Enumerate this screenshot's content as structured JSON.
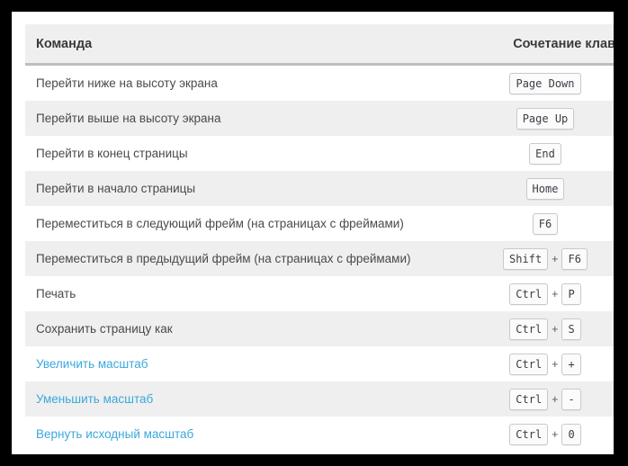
{
  "table": {
    "headers": {
      "command": "Команда",
      "shortcut": "Сочетание клавиш"
    },
    "colors": {
      "link": "#3ba7dd",
      "text": "#4a4a4a",
      "header_bg": "#efefef",
      "stripe_bg": "#efefef",
      "key_bg": "#fbfbfb",
      "key_border": "#c9c9c9",
      "page_bg": "#ffffff",
      "frame": "#000000"
    },
    "rows": [
      {
        "command": "Перейти ниже на высоту экрана",
        "is_link": false,
        "keys": [
          "Page Down"
        ]
      },
      {
        "command": "Перейти выше на высоту экрана",
        "is_link": false,
        "keys": [
          "Page Up"
        ]
      },
      {
        "command": "Перейти в конец страницы",
        "is_link": false,
        "keys": [
          "End"
        ]
      },
      {
        "command": "Перейти в начало страницы",
        "is_link": false,
        "keys": [
          "Home"
        ]
      },
      {
        "command": "Переместиться в следующий фрейм (на страницах с фреймами)",
        "is_link": false,
        "keys": [
          "F6"
        ]
      },
      {
        "command": "Переместиться в предыдущий фрейм (на страницах с фреймами)",
        "is_link": false,
        "keys": [
          "Shift",
          "F6"
        ]
      },
      {
        "command": "Печать",
        "is_link": false,
        "keys": [
          "Ctrl",
          "P"
        ]
      },
      {
        "command": "Сохранить страницу как",
        "is_link": false,
        "keys": [
          "Ctrl",
          "S"
        ]
      },
      {
        "command": "Увеличить масштаб",
        "is_link": true,
        "keys": [
          "Ctrl",
          "+"
        ]
      },
      {
        "command": "Уменьшить масштаб",
        "is_link": true,
        "keys": [
          "Ctrl",
          "-"
        ]
      },
      {
        "command": "Вернуть исходный масштаб",
        "is_link": true,
        "keys": [
          "Ctrl",
          "0"
        ]
      }
    ],
    "key_separator": "+"
  }
}
